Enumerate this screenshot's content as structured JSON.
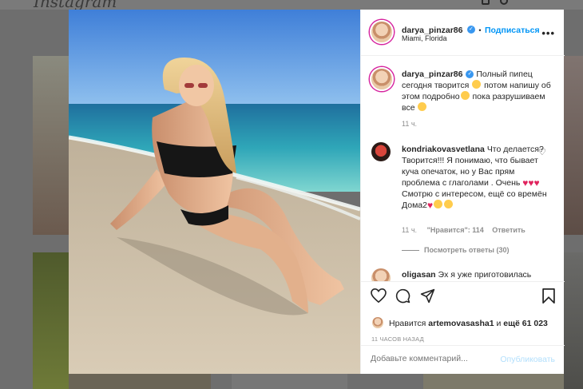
{
  "app": {
    "logo": "Instagram"
  },
  "post": {
    "author": "darya_pinzar86",
    "follow_label": "Подписаться",
    "location": "Miami, Florida",
    "caption": "Полный пипец сегодня творится",
    "caption_2": "потом напишу об этом подробно",
    "caption_3": "пока разрушиваем все",
    "caption_time": "11 ч."
  },
  "comments": [
    {
      "user": "kondriakovasvetlana",
      "text_1": "Что делается? Творится!!! Я понимаю, что бывает куча опечаток, но у Вас прям проблема с глаголами . Очень",
      "text_2": "Смотрю с интересом, ещё со времён Дома2",
      "time": "11 ч.",
      "likes": "\"Нравится\": 114",
      "reply": "Ответить",
      "view_replies": "Посмотреть ответы (30)"
    },
    {
      "user": "oligasan",
      "text_1": "Эх я уже приготовилась"
    }
  ],
  "likes": {
    "prefix": "Нравится",
    "user": "artemovasasha1",
    "middle": "и",
    "count": "ещё 61 023"
  },
  "timestamp": "11 ЧАСОВ НАЗАД",
  "comment_box": {
    "placeholder": "Добавьте комментарий...",
    "publish": "Опубликовать"
  },
  "icons": [
    "heart-icon",
    "comment-icon",
    "share-icon",
    "bookmark-icon",
    "more-icon",
    "verified-icon",
    "like-comment-icon"
  ],
  "colors": {
    "accent": "#0095f6",
    "verified": "#3897f0",
    "publish_disabled": "#b2dffc"
  }
}
